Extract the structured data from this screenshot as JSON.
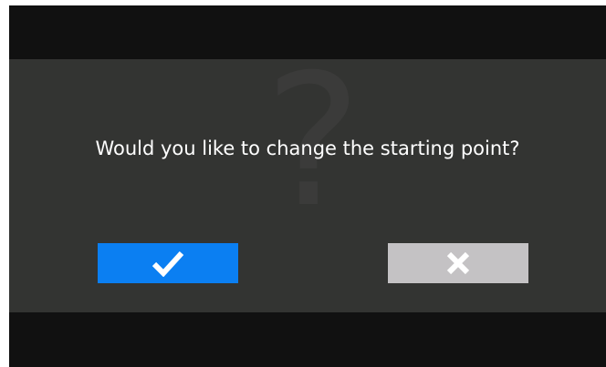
{
  "dialog": {
    "prompt": "Would you like to change the starting point?",
    "background_glyph": "?",
    "confirm_button": {
      "icon": "checkmark-icon",
      "color": "#0b7ff2"
    },
    "cancel_button": {
      "icon": "close-icon",
      "color": "#c4c2c4"
    }
  }
}
